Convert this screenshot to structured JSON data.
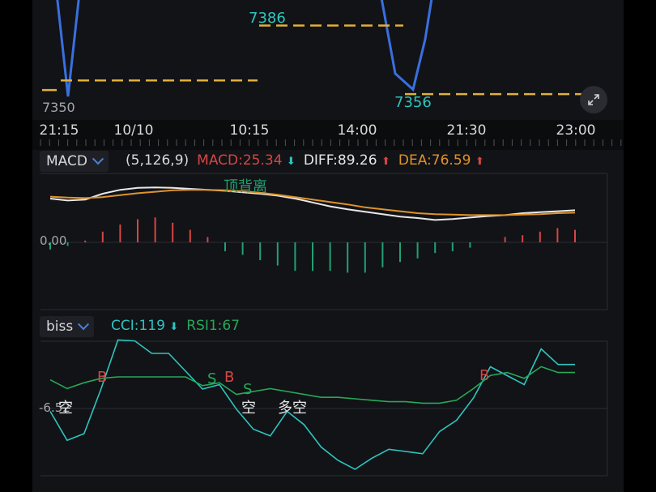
{
  "colors": {
    "price_line": "#3a6fe0",
    "dashed": "#e0b03a",
    "diff": "#e8e8ea",
    "dea": "#e0922a",
    "up": "#d84545",
    "down": "#21a173",
    "cci": "#2ec5c0",
    "rsi": "#27a85a",
    "label_grey": "#a3a6ad",
    "grid": "#2a2c32",
    "signal_b": "#d84545",
    "signal_s": "#27a85a",
    "text_white": "#e6e6e8"
  },
  "price_panel": {
    "price_labels": [
      "7386",
      "7356"
    ],
    "axis_min_label": "7350",
    "time_ticks": [
      "21:15",
      "10/10",
      "10:15",
      "14:00",
      "21:30",
      "23:00"
    ],
    "expand_icon": "expand-icon"
  },
  "macd_panel": {
    "selector_label": "MACD",
    "params": "(5,126,9)",
    "macd_text": "MACD:25.34",
    "diff_text": "DIFF:89.26",
    "dea_text": "DEA:76.59",
    "zero_label": "0.00",
    "annotation": "顶背离"
  },
  "biss_panel": {
    "selector_label": "biss",
    "cci_text": "CCI:119",
    "rsi_text": "RSI1:67",
    "axis_label": "-6.52",
    "signals": [
      "B",
      "S",
      "B",
      "S",
      "B"
    ],
    "text_signals": [
      "空",
      "空",
      "多空"
    ]
  },
  "chart_data": [
    {
      "type": "line",
      "title": "",
      "series": [
        {
          "values": [
            7400,
            7355,
            7400,
            7400,
            7400,
            7400,
            7400,
            7365,
            7358,
            7380,
            7400
          ]
        }
      ],
      "reference_lines": [
        {
          "label": "",
          "value": 7362
        },
        {
          "value": 7386,
          "label": "7386"
        },
        {
          "value": 7356,
          "label": "7356"
        }
      ],
      "ylim": [
        7350,
        7400
      ],
      "x_tick_labels": [
        "21:15",
        "10/10",
        "10:15",
        "14:00",
        "21:30",
        "23:00"
      ]
    },
    {
      "type": "bar",
      "title": "MACD",
      "series": [
        {
          "name": "DIFF",
          "values": [
            60,
            56,
            58,
            70,
            78,
            82,
            83,
            82,
            80,
            78,
            76,
            73,
            70,
            66,
            60,
            52,
            44,
            38,
            33,
            28,
            23,
            20,
            16,
            18,
            21,
            24,
            26,
            30,
            32,
            34,
            36
          ]
        },
        {
          "name": "DEA",
          "values": [
            64,
            62,
            61,
            63,
            67,
            71,
            74,
            77,
            78,
            78,
            77,
            75,
            72,
            68,
            63,
            58,
            53,
            48,
            42,
            38,
            34,
            30,
            28,
            27,
            26,
            26,
            26,
            27,
            28,
            30,
            31
          ]
        },
        {
          "name": "MACD",
          "values": [
            -4,
            -2,
            1,
            6,
            10,
            13,
            14,
            11,
            7,
            3,
            -5,
            -7,
            -10,
            -13,
            -16,
            -16,
            -16,
            -17,
            -17,
            -14,
            -11,
            -9,
            -6,
            -5,
            -3,
            0,
            3,
            4,
            6,
            8,
            7
          ]
        }
      ],
      "zero_label": "0.00"
    },
    {
      "type": "line",
      "title": "biss",
      "series": [
        {
          "name": "CCI",
          "values": [
            -10,
            -75,
            -60,
            40,
            150,
            148,
            120,
            120,
            80,
            40,
            50,
            -5,
            -50,
            -65,
            -10,
            -40,
            -90,
            -120,
            -140,
            -115,
            -95,
            -100,
            -105,
            -55,
            -30,
            20,
            90,
            70,
            50,
            130,
            95,
            95
          ]
        },
        {
          "name": "RSI1",
          "values": [
            62,
            56,
            60,
            63,
            64,
            64,
            64,
            64,
            64,
            58,
            60,
            52,
            54,
            56,
            54,
            52,
            50,
            50,
            49,
            48,
            47,
            47,
            46,
            46,
            48,
            56,
            65,
            67,
            63,
            71,
            67,
            67
          ]
        }
      ],
      "signals": [
        {
          "label": "B",
          "index": 3
        },
        {
          "label": "S",
          "index": 10
        },
        {
          "label": "B",
          "index": 11
        },
        {
          "label": "S",
          "index": 12
        },
        {
          "label": "B",
          "index": 25
        }
      ],
      "axis_label": "-6.52"
    }
  ]
}
